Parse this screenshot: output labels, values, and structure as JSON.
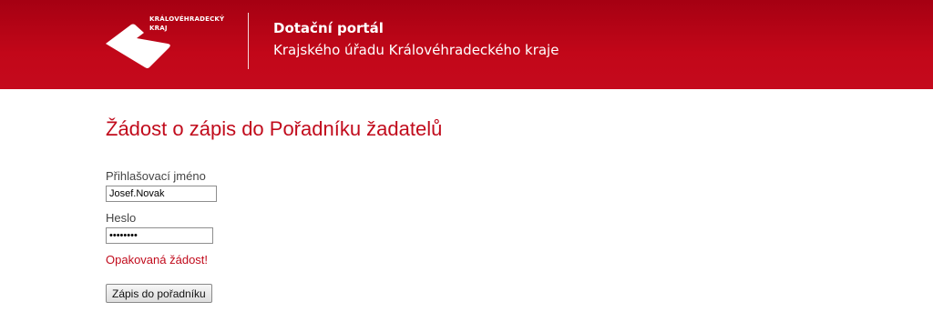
{
  "header": {
    "logo_line1": "KRÁLOVÉHRADECKÝ",
    "logo_line2": "KRAJ",
    "title": "Dotační portál",
    "subtitle": "Krajského úřadu Královéhradeckého kraje"
  },
  "main": {
    "page_title": "Žádost o zápis do Pořadníku žadatelů",
    "username_label": "Přihlašovací jméno",
    "username_value": "Josef.Novak",
    "password_label": "Heslo",
    "password_value": "12345678",
    "error_message": "Opakovaná žádost!",
    "submit_label": "Zápis do pořadníku"
  },
  "colors": {
    "header_red": "#c20719",
    "accent_red": "#c10b1c"
  },
  "icons": {
    "logo": "kraj-logo-icon"
  }
}
